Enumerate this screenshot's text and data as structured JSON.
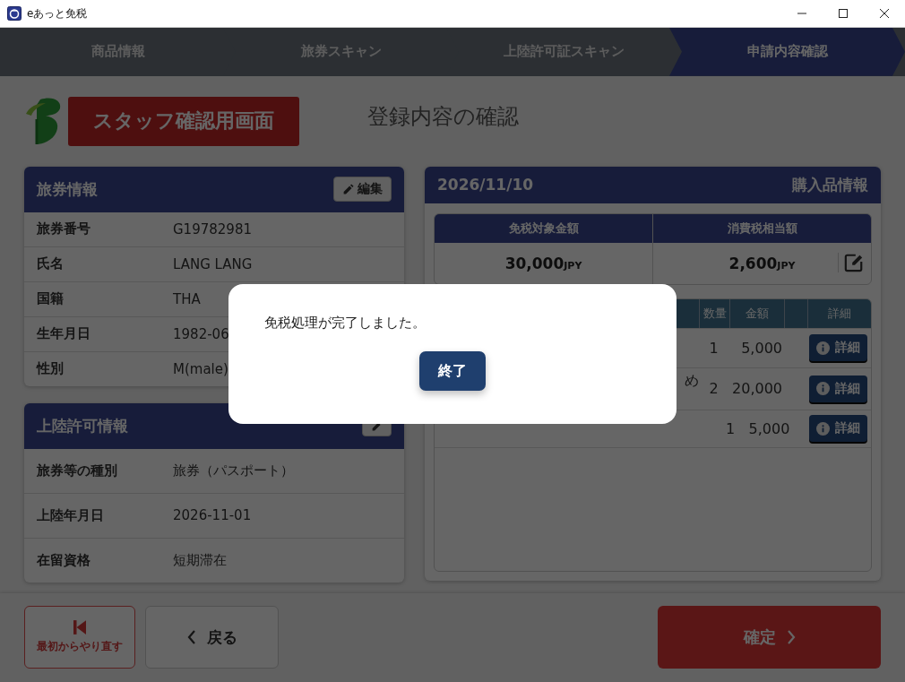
{
  "window": {
    "title": "eあっと免税"
  },
  "steps": [
    {
      "label": "商品情報",
      "selected": false
    },
    {
      "label": "旅券スキャン",
      "selected": false
    },
    {
      "label": "上陸許可証スキャン",
      "selected": false
    },
    {
      "label": "申請内容確認",
      "selected": true
    }
  ],
  "staff_badge": "スタッフ確認用画面",
  "page_title": "登録内容の確認",
  "passport": {
    "title": "旅券情報",
    "edit_button": "編集",
    "rows": [
      {
        "label": "旅券番号",
        "value": "G19782981"
      },
      {
        "label": "氏名",
        "value": "LANG LANG"
      },
      {
        "label": "国籍",
        "value": "THA"
      },
      {
        "label": "生年月日",
        "value": "1982-06"
      },
      {
        "label": "性別",
        "value": "M(male)"
      }
    ]
  },
  "landing_permit": {
    "title": "上陸許可情報",
    "rows": [
      {
        "label": "旅券等の種別",
        "value": "旅券（パスポート）"
      },
      {
        "label": "上陸年月日",
        "value": "2026-11-01"
      },
      {
        "label": "在留資格",
        "value": "短期滞在"
      }
    ]
  },
  "purchase": {
    "date": "2026/11/10",
    "title": "購入品情報",
    "summary": [
      {
        "label": "免税対象金額",
        "amount": "30,000",
        "unit": "JPY",
        "editable": false
      },
      {
        "label": "消費税相当額",
        "amount": "2,600",
        "unit": "JPY",
        "editable": true
      }
    ],
    "table": {
      "columns": {
        "quantity": "数量",
        "amount": "金額",
        "detail": "詳細"
      },
      "rows": [
        {
          "quantity": "1",
          "amount": "5,000",
          "detail_button": "詳細"
        },
        {
          "name": "め",
          "quantity": "2",
          "amount": "20,000",
          "detail_button": "詳細"
        },
        {
          "quantity": "1",
          "amount": "5,000",
          "detail_button": "詳細"
        }
      ]
    }
  },
  "dialog": {
    "message": "免税処理が完了しました。",
    "button": "終了"
  },
  "footer": {
    "restart": "最初からやり直す",
    "back": "戻る",
    "confirm": "確定"
  }
}
